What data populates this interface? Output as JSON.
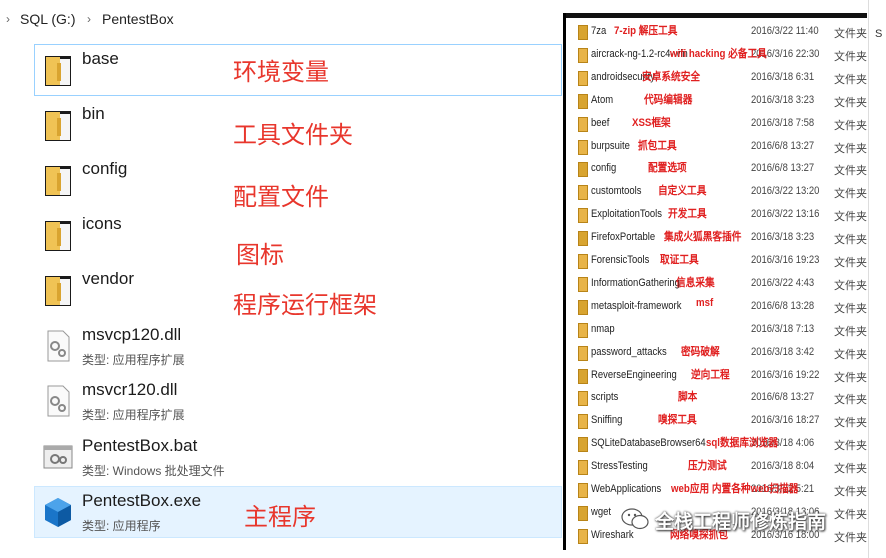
{
  "breadcrumb": {
    "drive": "SQL (G:)",
    "folder": "PentestBox"
  },
  "files": [
    {
      "name": "base",
      "type": "",
      "annotation": "环境变量",
      "icon": "folder-icon"
    },
    {
      "name": "bin",
      "type": "",
      "annotation": "工具文件夹",
      "icon": "folder-icon"
    },
    {
      "name": "config",
      "type": "",
      "annotation": "配置文件",
      "icon": "folder-icon"
    },
    {
      "name": "icons",
      "type": "",
      "annotation": "图标",
      "icon": "folder-icon"
    },
    {
      "name": "vendor",
      "type": "",
      "annotation": "程序运行框架",
      "icon": "folder-icon"
    },
    {
      "name": "msvcp120.dll",
      "type": "类型: 应用程序扩展",
      "annotation": "",
      "icon": "dll-icon"
    },
    {
      "name": "msvcr120.dll",
      "type": "类型: 应用程序扩展",
      "annotation": "",
      "icon": "dll-icon"
    },
    {
      "name": "PentestBox.bat",
      "type": "类型: Windows 批处理文件",
      "annotation": "",
      "icon": "bat-icon"
    },
    {
      "name": "PentestBox.exe",
      "type": "类型: 应用程序",
      "annotation": "主程序",
      "icon": "exe-icon"
    }
  ],
  "tools": [
    {
      "name": "7za",
      "date": "2016/3/22 11:40",
      "type": "文件夹",
      "note": "7-zip 解压工具"
    },
    {
      "name": "aircrack-ng-1.2-rc4-win",
      "date": "2016/3/16 22:30",
      "type": "文件夹",
      "note": "wifi hacking 必备工具"
    },
    {
      "name": "androidsecurity",
      "date": "2016/3/18 6:31",
      "type": "文件夹",
      "note": "安卓系统安全"
    },
    {
      "name": "Atom",
      "date": "2016/3/18 3:23",
      "type": "文件夹",
      "note": "代码编辑器"
    },
    {
      "name": "beef",
      "date": "2016/3/18 7:58",
      "type": "文件夹",
      "note": "XSS框架"
    },
    {
      "name": "burpsuite",
      "date": "2016/6/8 13:27",
      "type": "文件夹",
      "note": "抓包工具"
    },
    {
      "name": "config",
      "date": "2016/6/8 13:27",
      "type": "文件夹",
      "note": "配置选项"
    },
    {
      "name": "customtools",
      "date": "2016/3/22 13:20",
      "type": "文件夹",
      "note": "自定义工具"
    },
    {
      "name": "ExploitationTools",
      "date": "2016/3/22 13:16",
      "type": "文件夹",
      "note": "开发工具"
    },
    {
      "name": "FirefoxPortable",
      "date": "2016/3/18 3:23",
      "type": "文件夹",
      "note": "集成火狐黑客插件"
    },
    {
      "name": "ForensicTools",
      "date": "2016/3/16 19:23",
      "type": "文件夹",
      "note": "取证工具"
    },
    {
      "name": "InformationGathering",
      "date": "2016/3/22 4:43",
      "type": "文件夹",
      "note": "信息采集"
    },
    {
      "name": "metasploit-framework",
      "date": "2016/6/8 13:28",
      "type": "文件夹",
      "note": "msf"
    },
    {
      "name": "nmap",
      "date": "2016/3/18 7:13",
      "type": "文件夹",
      "note": ""
    },
    {
      "name": "password_attacks",
      "date": "2016/3/18 3:42",
      "type": "文件夹",
      "note": "密码破解"
    },
    {
      "name": "ReverseEngineering",
      "date": "2016/3/16 19:22",
      "type": "文件夹",
      "note": "逆向工程"
    },
    {
      "name": "scripts",
      "date": "2016/6/8 13:27",
      "type": "文件夹",
      "note": "脚本"
    },
    {
      "name": "Sniffing",
      "date": "2016/3/16 18:27",
      "type": "文件夹",
      "note": "嗅探工具"
    },
    {
      "name": "SQLiteDatabaseBrowser64",
      "date": "2016/3/18 4:06",
      "type": "文件夹",
      "note": "sql数据库浏览器"
    },
    {
      "name": "StressTesting",
      "date": "2016/3/18 8:04",
      "type": "文件夹",
      "note": "压力测试"
    },
    {
      "name": "WebApplications",
      "date": "2016/3/22 5:21",
      "type": "文件夹",
      "note": "web应用 内置各种web扫描器"
    },
    {
      "name": "wget",
      "date": "2016/3/18 13:06",
      "type": "文件夹",
      "note": ""
    },
    {
      "name": "Wireshark",
      "date": "2016/3/16 18:00",
      "type": "文件夹",
      "note": "网络嗅探抓包"
    }
  ],
  "watermark": "全栈工程师修炼指南",
  "edge_label": "S",
  "colors": {
    "annotation": "#e8362c",
    "folder": "#e8b448",
    "selection": "#e5f3ff"
  }
}
